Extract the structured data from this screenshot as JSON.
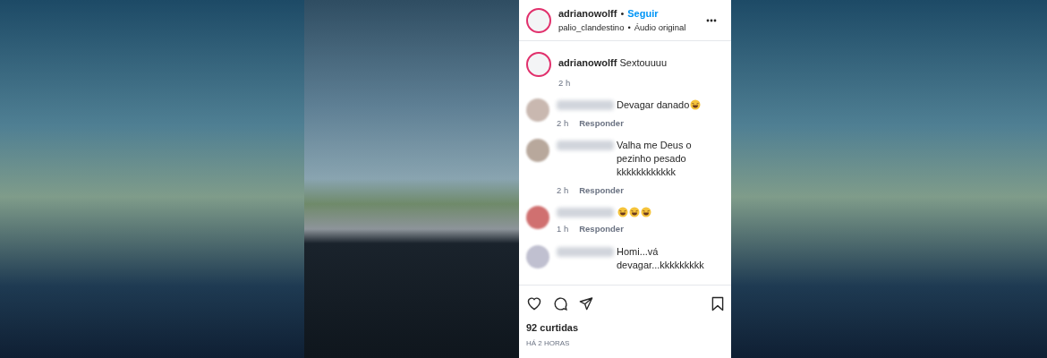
{
  "post": {
    "author": "adrianowolff",
    "separator": "•",
    "follow": "Seguir",
    "audio_user": "palio_clandestino",
    "audio_separator": "•",
    "audio": "Áudio original"
  },
  "caption": {
    "author": "adrianowolff",
    "text": "Sextouuuu",
    "time": "2 h"
  },
  "comments": [
    {
      "text": "Devagar danado",
      "emojis": [
        {
          "kind": "laughing"
        }
      ],
      "time": "2 h",
      "reply": "Responder"
    },
    {
      "text": "Valha me Deus o pezinho pesado kkkkkkkkkkkk",
      "time": "2 h",
      "reply": "Responder"
    },
    {
      "emojis": [
        {
          "kind": "laughing"
        },
        {
          "kind": "laughing"
        },
        {
          "kind": "laughing"
        }
      ],
      "time": "1 h",
      "reply": "Responder"
    },
    {
      "text": "Homi...vá devagar...kkkkkkkkk"
    }
  ],
  "likes": "92 curtidas",
  "posted": "HÁ 2 HORAS"
}
